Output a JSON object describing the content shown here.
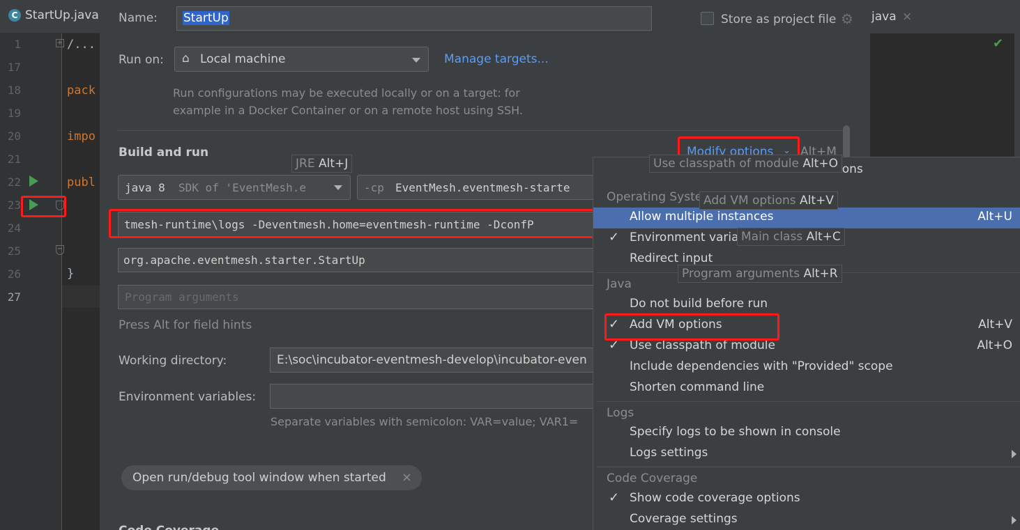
{
  "editor": {
    "tab_label": "StartUp.java",
    "right_tab_label": "java",
    "line_numbers": [
      "1",
      "17",
      "18",
      "19",
      "20",
      "21",
      "22",
      "23",
      "24",
      "25",
      "26",
      "27"
    ],
    "code": {
      "fold": "/...",
      "pack": "pack",
      "impo": "impo",
      "publ": "publ",
      "brace": "}"
    }
  },
  "dialog": {
    "name_label": "Name:",
    "name_value": "StartUp",
    "store_label": "Store as project file",
    "run_on_label": "Run on:",
    "run_on_value": "Local machine",
    "manage_targets": "Manage targets...",
    "run_on_hint_1": "Run configurations may be executed locally or on a target: for",
    "run_on_hint_2": "example in a Docker Container or on a remote host using SSH.",
    "build_run_heading": "Build and run",
    "modify_options": "Modify options",
    "modify_shortcut": "Alt+M",
    "jre_value": "java 8",
    "jre_sdk": "SDK of 'EventMesh.e",
    "cp_prefix": "-cp",
    "cp_value": "EventMesh.eventmesh-starte",
    "vm_options_value": "tmesh-runtime\\logs -Deventmesh.home=eventmesh-runtime -DconfP",
    "main_class_value": "org.apache.eventmesh.starter.StartUp",
    "program_args_placeholder": "Program arguments",
    "field_hints": "Press Alt for field hints",
    "working_dir_label": "Working directory:",
    "working_dir_value": "E:\\soc\\incubator-eventmesh-develop\\incubator-even",
    "env_label": "Environment variables:",
    "env_value": "",
    "env_hint": "Separate variables with semicolon: VAR=value; VAR1=",
    "chip_label": "Open run/debug tool window when started",
    "code_coverage_partial": "Code Coverage"
  },
  "tooltips": {
    "jre": {
      "label": "JRE",
      "key": "Alt+J"
    },
    "classpath": {
      "label": "Use classpath of module",
      "key": "Alt+O",
      "tail": "ions"
    },
    "vm": {
      "label": "Add VM options",
      "key": "Alt+V"
    },
    "main": {
      "label": "Main class",
      "key": "Alt+C"
    },
    "args": {
      "label": "Program arguments",
      "key": "Alt+R"
    }
  },
  "menu": {
    "os_header": "Operating Syste",
    "allow_multiple": {
      "label": "Allow multiple instances",
      "shortcut": "Alt+U"
    },
    "env_vars": {
      "label": "Environment varia"
    },
    "redirect_input": {
      "label": "Redirect input"
    },
    "java_header": "Java",
    "do_not_build": {
      "label": "Do not build before run"
    },
    "add_vm": {
      "label": "Add VM options",
      "shortcut": "Alt+V"
    },
    "use_classpath": {
      "label": "Use classpath of module",
      "shortcut": "Alt+O"
    },
    "include_deps": {
      "label": "Include dependencies with \"Provided\" scope"
    },
    "shorten_cmd": {
      "label": "Shorten command line"
    },
    "logs_header": "Logs",
    "specify_logs": {
      "label": "Specify logs to be shown in console"
    },
    "logs_settings": {
      "label": "Logs settings"
    },
    "coverage_header": "Code Coverage",
    "show_coverage": {
      "label": "Show code coverage options"
    },
    "coverage_settings": {
      "label": "Coverage settings"
    },
    "check_glyph": "✓"
  },
  "colors": {
    "highlight_red": "#ff1a1a",
    "selection_blue": "#4b6eaf",
    "link_blue": "#589df6",
    "run_green": "#499c54"
  }
}
